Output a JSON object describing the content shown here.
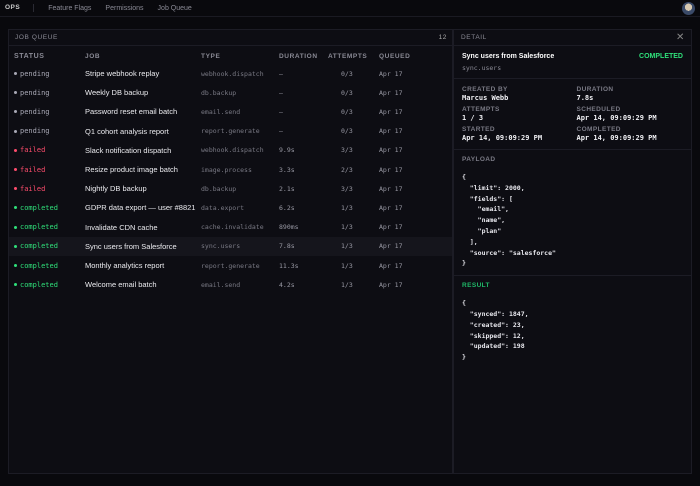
{
  "topbar": {
    "brand": "OPS",
    "nav": [
      "Feature Flags",
      "Permissions",
      "Job Queue"
    ]
  },
  "queue": {
    "title": "JOB QUEUE",
    "count": "12",
    "columns": [
      "STATUS",
      "JOB",
      "TYPE",
      "DURATION",
      "ATTEMPTS",
      "QUEUED"
    ],
    "rows": [
      {
        "status": "pending",
        "job": "Stripe webhook replay",
        "type": "webhook.dispatch",
        "duration": "—",
        "attempts": "0/3",
        "queued": "Apr 17"
      },
      {
        "status": "pending",
        "job": "Weekly DB backup",
        "type": "db.backup",
        "duration": "—",
        "attempts": "0/3",
        "queued": "Apr 17"
      },
      {
        "status": "pending",
        "job": "Password reset email batch",
        "type": "email.send",
        "duration": "—",
        "attempts": "0/3",
        "queued": "Apr 17"
      },
      {
        "status": "pending",
        "job": "Q1 cohort analysis report",
        "type": "report.generate",
        "duration": "—",
        "attempts": "0/3",
        "queued": "Apr 17"
      },
      {
        "status": "failed",
        "job": "Slack notification dispatch",
        "type": "webhook.dispatch",
        "duration": "9.9s",
        "attempts": "3/3",
        "queued": "Apr 17"
      },
      {
        "status": "failed",
        "job": "Resize product image batch",
        "type": "image.process",
        "duration": "3.3s",
        "attempts": "2/3",
        "queued": "Apr 17"
      },
      {
        "status": "failed",
        "job": "Nightly DB backup",
        "type": "db.backup",
        "duration": "2.1s",
        "attempts": "3/3",
        "queued": "Apr 17"
      },
      {
        "status": "completed",
        "job": "GDPR data export — user #8821",
        "type": "data.export",
        "duration": "6.2s",
        "attempts": "1/3",
        "queued": "Apr 17"
      },
      {
        "status": "completed",
        "job": "Invalidate CDN cache",
        "type": "cache.invalidate",
        "duration": "890ms",
        "attempts": "1/3",
        "queued": "Apr 17"
      },
      {
        "status": "completed",
        "job": "Sync users from Salesforce",
        "type": "sync.users",
        "duration": "7.8s",
        "attempts": "1/3",
        "queued": "Apr 17"
      },
      {
        "status": "completed",
        "job": "Monthly analytics report",
        "type": "report.generate",
        "duration": "11.3s",
        "attempts": "1/3",
        "queued": "Apr 17"
      },
      {
        "status": "completed",
        "job": "Welcome email batch",
        "type": "email.send",
        "duration": "4.2s",
        "attempts": "1/3",
        "queued": "Apr 17"
      }
    ]
  },
  "detail": {
    "title": "DETAIL",
    "job": "Sync users from Salesforce",
    "type": "sync.users",
    "badge": "COMPLETED",
    "fields": [
      {
        "label": "CREATED BY",
        "value": "Marcus Webb"
      },
      {
        "label": "DURATION",
        "value": "7.8s"
      },
      {
        "label": "ATTEMPTS",
        "value": "1 / 3"
      },
      {
        "label": "SCHEDULED",
        "value": "Apr 14, 09:09:29 PM"
      },
      {
        "label": "STARTED",
        "value": "Apr 14, 09:09:29 PM"
      },
      {
        "label": "COMPLETED",
        "value": "Apr 14, 09:09:29 PM"
      }
    ],
    "payload_label": "PAYLOAD",
    "payload": "{\n  \"limit\": 2000,\n  \"fields\": [\n    \"email\",\n    \"name\",\n    \"plan\"\n  ],\n  \"source\": \"salesforce\"\n}",
    "result_label": "RESULT",
    "result": "{\n  \"synced\": 1847,\n  \"created\": 23,\n  \"skipped\": 12,\n  \"updated\": 198\n}"
  },
  "colors": {
    "pending": "#a8a8b5",
    "failed": "#ff4d6d",
    "completed": "#2fe07a"
  }
}
